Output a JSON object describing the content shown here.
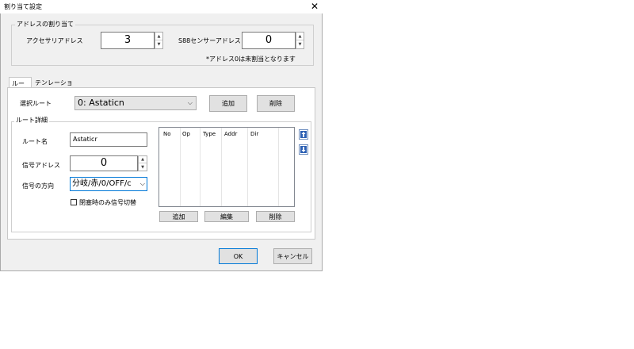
{
  "window": {
    "title": "割り当て設定",
    "close_glyph": "✕"
  },
  "address_group": {
    "legend": "アドレスの割り当て",
    "accessory_label": "アクセサリアドレス",
    "accessory_value": "3",
    "s88_label": "S88センサーアドレス",
    "s88_value": "0",
    "note": "*アドレス0は未割当となります"
  },
  "tabs": [
    {
      "label": "ルート"
    },
    {
      "label": "テンレーション"
    }
  ],
  "route": {
    "select_label": "選択ルート",
    "select_value": "0: Astaticn",
    "add_button": "追加",
    "delete_button": "削除"
  },
  "route_details": {
    "legend": "ルート詳細",
    "name_label": "ルート名",
    "name_value": "Astaticr",
    "signal_addr_label": "信号アドレス",
    "signal_addr_value": "0",
    "signal_dir_label": "信号の方向",
    "signal_dir_value": "分岐/赤/0/OFF/c",
    "checkbox_label": "閉塞時のみ信号切替",
    "columns": [
      "No",
      "Op",
      "Type",
      "Addr",
      "Dir"
    ],
    "list_add_button": "追加",
    "list_edit_button": "編集",
    "list_delete_button": "削除"
  },
  "footer": {
    "ok_label": "OK",
    "cancel_label": "キャンセル"
  },
  "colors": {
    "dialog_bg": "#f0f0f0",
    "accent": "#0078d7",
    "icon_blue": "#2b5fb3"
  },
  "icons": {
    "up": "arrow-up-icon",
    "down": "arrow-down-icon",
    "dropdown": "chevron-down-icon"
  }
}
